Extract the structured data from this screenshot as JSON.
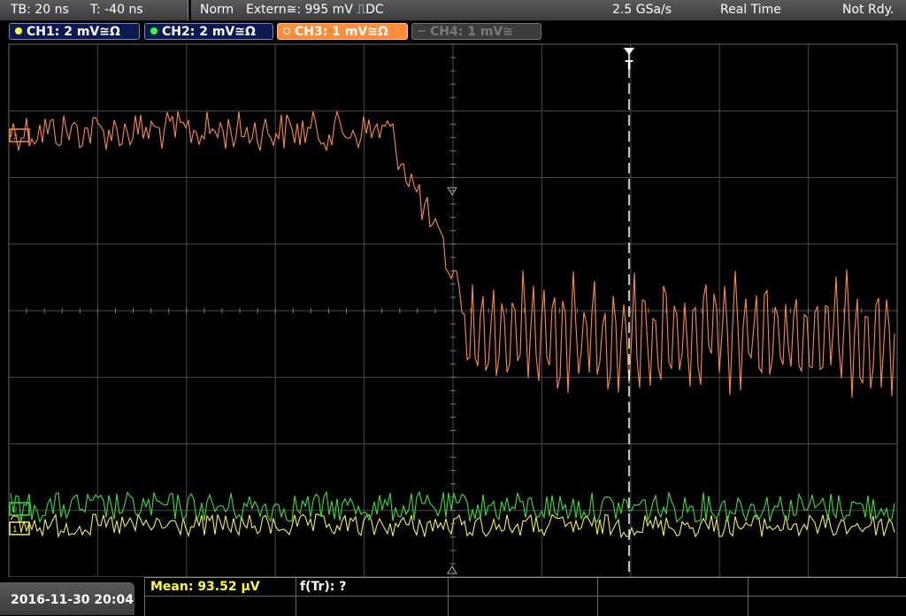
{
  "top_bar": {
    "timebase": "TB: 20 ns",
    "trigger_time": "T: -40 ns",
    "mode": "Norm",
    "trigger_source": "Extern≅: 995 mV ⎍DC",
    "sample_rate": "2.5 GSa/s",
    "acq_mode": "Real Time",
    "status": "Not Rdy."
  },
  "channels": [
    {
      "label": "CH1: 2 mV≅Ω",
      "color": "#ffff33",
      "active": true
    },
    {
      "label": "CH2: 2 mV≅Ω",
      "color": "#33ff33",
      "active": true
    },
    {
      "label": "CH3: 1 mV≅Ω",
      "color": "#ff8c3a",
      "active": true,
      "selected": true
    },
    {
      "label": "CH4: 1 mV≅",
      "color": "#888888",
      "active": false
    }
  ],
  "trigger_marker": "T",
  "bottom": {
    "datetime": "2016-11-30 20:04",
    "mean_label": "Mean: 93.52 µV",
    "ftr_label": "f(Tr): ?"
  },
  "colors": {
    "ch1": "#f5f04a",
    "ch2": "#39e03a",
    "ch3": "#ff8c3a",
    "grid": "#4a4a4a"
  }
}
